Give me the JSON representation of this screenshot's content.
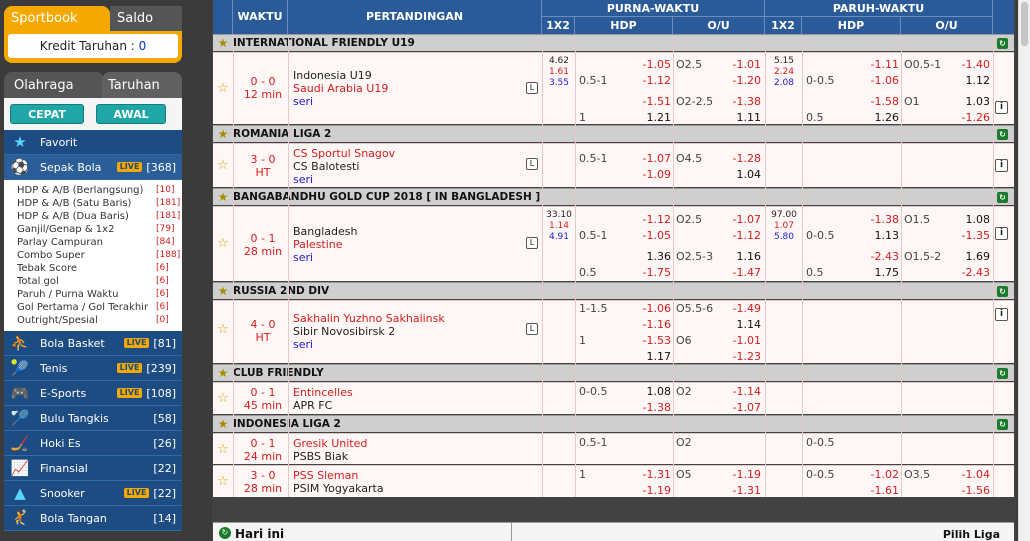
{
  "sidebar": {
    "tabs": {
      "sportsbook": "Sportbook",
      "balance": "Saldo"
    },
    "credit": {
      "label": "Kredit Taruhan :",
      "value": "0"
    },
    "tabs2": {
      "sports": "Olahraga",
      "bets": "Taruhan"
    },
    "buttons": {
      "quick": "CEPAT",
      "start": "AWAL"
    },
    "favorite": "Favorit",
    "soccer": {
      "label": "Sepak Bola",
      "live": "LIVE",
      "count": "[368]"
    },
    "soccer_sub": [
      {
        "label": "HDP & A/B (Berlangsung)",
        "count": "[10]"
      },
      {
        "label": "HDP & A/B (Satu Baris)",
        "count": "[181]"
      },
      {
        "label": "HDP & A/B (Dua Baris)",
        "count": "[181]"
      },
      {
        "label": "Ganjil/Genap & 1x2",
        "count": "[79]"
      },
      {
        "label": "Parlay Campuran",
        "count": "[84]"
      },
      {
        "label": "Combo Super",
        "count": "[188]"
      },
      {
        "label": "Tebak Score",
        "count": "[6]"
      },
      {
        "label": "Total gol",
        "count": "[6]"
      },
      {
        "label": "Paruh / Purna Waktu",
        "count": "[6]"
      },
      {
        "label": "Gol Pertama / Gol Terakhir",
        "count": "[6]"
      },
      {
        "label": "Outright/Spesial",
        "count": "[0]"
      }
    ],
    "sports": [
      {
        "label": "Bola Basket",
        "live": "LIVE",
        "count": "[81]",
        "icon": "basketball-icon"
      },
      {
        "label": "Tenis",
        "live": "LIVE",
        "count": "[239]",
        "icon": "tennis-icon"
      },
      {
        "label": "E-Sports",
        "live": "LIVE",
        "count": "[108]",
        "icon": "esports-icon"
      },
      {
        "label": "Bulu Tangkis",
        "live": "",
        "count": "[58]",
        "icon": "badminton-icon"
      },
      {
        "label": "Hoki Es",
        "live": "",
        "count": "[26]",
        "icon": "ice-hockey-icon"
      },
      {
        "label": "Finansial",
        "live": "",
        "count": "[22]",
        "icon": "financial-icon"
      },
      {
        "label": "Snooker",
        "live": "LIVE",
        "count": "[22]",
        "icon": "snooker-icon"
      },
      {
        "label": "Bola Tangan",
        "live": "",
        "count": "[14]",
        "icon": "handball-icon"
      }
    ]
  },
  "header": {
    "time": "WAKTU",
    "match": "PERTANDINGAN",
    "fulltime": "PURNA-WAKTU",
    "halftime": "PARUH-WAKTU",
    "c1x2": "1X2",
    "hdp": "HDP",
    "ou": "O/U"
  },
  "leagues": {
    "l1": "INTERNATIONAL FRIENDLY U19",
    "l2": "ROMANIA LIGA 2",
    "l3": "BANGABANDHU GOLD CUP 2018 [ IN BANGLADESH ]",
    "l4": "RUSSIA 2ND DIV",
    "l5": "CLUB FRIENDLY",
    "l6": "INDONESIA LIGA 2"
  },
  "matches": {
    "m1": {
      "score": "0 - 0",
      "time": "12 min",
      "home": "Indonesia U19",
      "away": "Saudi Arabia U19",
      "draw": "seri",
      "ft1x2": [
        "4.62",
        "1.61",
        "3.55"
      ],
      "ht1x2": [
        "5.15",
        "2.24",
        "2.08"
      ],
      "r1": {
        "fh_line": "",
        "fh_p": "-1.05",
        "fo_line": "O2.5",
        "fo_p": "-1.01",
        "hh_line": "",
        "hh_p": "-1.11",
        "ho_line": "O0.5-1",
        "ho_p": "-1.40"
      },
      "r2": {
        "fh_line": "0.5-1",
        "fh_p": "-1.12",
        "fo_line": "",
        "fo_p": "-1.20",
        "hh_line": "0-0.5",
        "hh_p": "-1.06",
        "ho_line": "",
        "ho_p": "1.12"
      },
      "r3": {
        "fh_line": "",
        "fh_p": "-1.51",
        "fo_line": "O2-2.5",
        "fo_p": "-1.38",
        "hh_line": "",
        "hh_p": "-1.58",
        "ho_line": "O1",
        "ho_p": "1.03"
      },
      "r4": {
        "fh_line": "1",
        "fh_p": "1.21",
        "fo_line": "",
        "fo_p": "1.11",
        "hh_line": "0.5",
        "hh_p": "1.26",
        "ho_line": "",
        "ho_p": "-1.26"
      }
    },
    "m2": {
      "score": "3 - 0",
      "time": "HT",
      "home": "CS Sportul Snagov",
      "away": "CS Balotesti",
      "draw": "seri",
      "r1": {
        "fh_line": "0.5-1",
        "fh_p": "-1.07",
        "fo_line": "O4.5",
        "fo_p": "-1.28"
      },
      "r2": {
        "fh_line": "",
        "fh_p": "-1.09",
        "fo_line": "",
        "fo_p": "1.04"
      }
    },
    "m3": {
      "score": "0 - 1",
      "time": "28 min",
      "home": "Bangladesh",
      "away": "Palestine",
      "draw": "seri",
      "ft1x2": [
        "33.10",
        "1.14",
        "4.91"
      ],
      "ht1x2": [
        "97.00",
        "1.07",
        "5.80"
      ],
      "r1": {
        "fh_line": "",
        "fh_p": "-1.12",
        "fo_line": "O2.5",
        "fo_p": "-1.07",
        "hh_line": "",
        "hh_p": "-1.38",
        "ho_line": "O1.5",
        "ho_p": "1.08"
      },
      "r2": {
        "fh_line": "0.5-1",
        "fh_p": "-1.05",
        "fo_line": "",
        "fo_p": "-1.12",
        "hh_line": "0-0.5",
        "hh_p": "1.13",
        "ho_line": "",
        "ho_p": "-1.35"
      },
      "r3": {
        "fh_line": "",
        "fh_p": "1.36",
        "fo_line": "O2.5-3",
        "fo_p": "1.16",
        "hh_line": "",
        "hh_p": "-2.43",
        "ho_line": "O1.5-2",
        "ho_p": "1.69"
      },
      "r4": {
        "fh_line": "0.5",
        "fh_p": "-1.75",
        "fo_line": "",
        "fo_p": "-1.47",
        "hh_line": "0.5",
        "hh_p": "1.75",
        "ho_line": "",
        "ho_p": "-2.43"
      }
    },
    "m4": {
      "score": "4 - 0",
      "time": "HT",
      "home": "Sakhalin Yuzhno Sakhalinsk",
      "away": "Sibir Novosibirsk 2",
      "draw": "seri",
      "r1": {
        "fh_line": "1-1.5",
        "fh_p": "-1.06",
        "fo_line": "O5.5-6",
        "fo_p": "-1.49"
      },
      "r2": {
        "fh_line": "",
        "fh_p": "-1.16",
        "fo_line": "",
        "fo_p": "1.14"
      },
      "r3": {
        "fh_line": "1",
        "fh_p": "-1.53",
        "fo_line": "O6",
        "fo_p": "-1.01"
      },
      "r4": {
        "fh_line": "",
        "fh_p": "1.17",
        "fo_line": "",
        "fo_p": "-1.23"
      }
    },
    "m5": {
      "score": "0 - 1",
      "time": "45 min",
      "home": "Entincelles",
      "away": "APR FC",
      "r1": {
        "fh_line": "0-0.5",
        "fh_p": "1.08",
        "fo_line": "O2",
        "fo_p": "-1.14"
      },
      "r2": {
        "fh_line": "",
        "fh_p": "-1.38",
        "fo_line": "",
        "fo_p": "-1.07"
      }
    },
    "m6": {
      "score": "0 - 1",
      "time": "24 min",
      "home": "Gresik United",
      "away": "PSBS Biak",
      "r1": {
        "fh_line": "0.5-1",
        "fo_line": "O2",
        "hh_line": "0-0.5"
      }
    },
    "m7": {
      "score": "3 - 0",
      "time": "28 min",
      "home": "PSS Sleman",
      "away": "PSIM Yogyakarta",
      "r1": {
        "fh_line": "1",
        "fh_p": "-1.31",
        "fo_line": "O5",
        "fo_p": "-1.19",
        "hh_line": "0-0.5",
        "hh_p": "-1.02",
        "ho_line": "O3.5",
        "ho_p": "-1.04"
      },
      "r2": {
        "fh_line": "",
        "fh_p": "-1.19",
        "fo_line": "",
        "fo_p": "-1.31",
        "hh_line": "",
        "hh_p": "-1.61",
        "ho_line": "",
        "ho_p": "-1.56"
      }
    }
  },
  "footer": {
    "today": "Hari ini",
    "pick_league": "Pilih Liga"
  },
  "icons": {
    "L": "L",
    "info": "i"
  }
}
